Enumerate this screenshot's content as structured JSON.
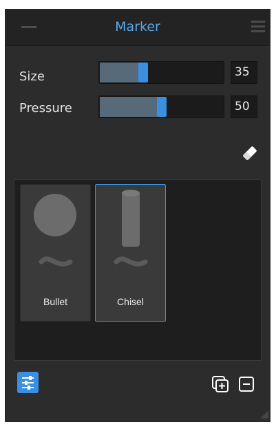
{
  "panel": {
    "title": "Marker"
  },
  "settings": {
    "size": {
      "label": "Size",
      "value": "35",
      "fraction": 0.35
    },
    "pressure": {
      "label": "Pressure",
      "value": "50",
      "fraction": 0.5
    }
  },
  "brushes": [
    {
      "name": "Bullet",
      "selected": false,
      "icon": "round-tip-icon"
    },
    {
      "name": "Chisel",
      "selected": true,
      "icon": "chisel-tip-icon"
    }
  ],
  "colors": {
    "accent": "#3a8fe0",
    "title": "#5aa7ea",
    "panel_bg": "#2c2c2c"
  },
  "icons": {
    "collapse": "minus-icon",
    "menu": "hamburger-menu-icon",
    "eraser": "eraser-icon",
    "settings": "sliders-icon",
    "duplicate": "duplicate-add-icon",
    "remove": "remove-icon",
    "resize": "resize-grip-icon"
  }
}
